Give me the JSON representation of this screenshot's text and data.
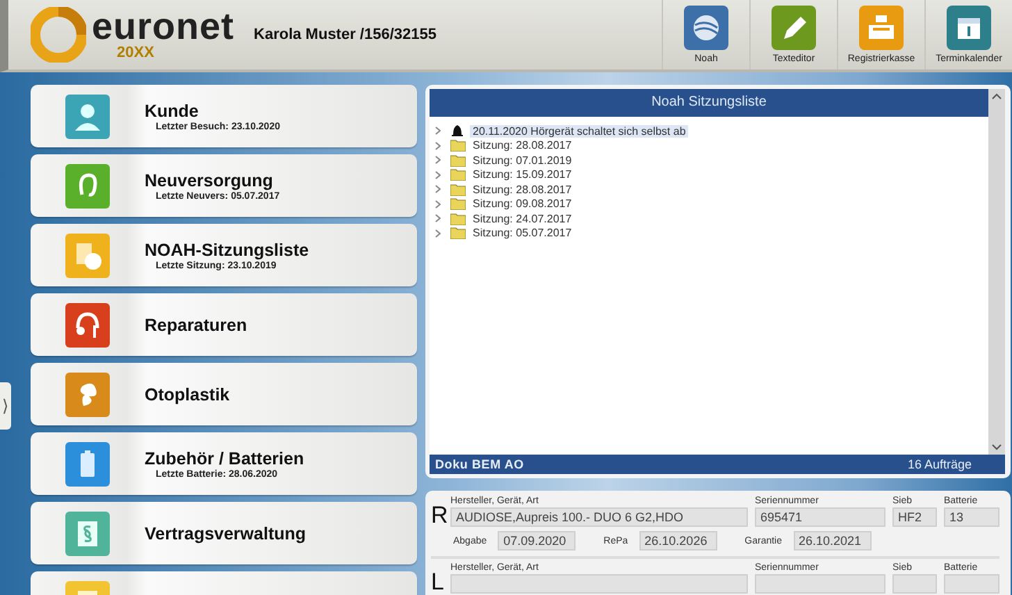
{
  "header": {
    "logo": {
      "name": "euronet",
      "edition": "20XX"
    },
    "customer": "Karola Muster /156/32155",
    "toolbar": [
      {
        "label": "Noah",
        "kind": "noah"
      },
      {
        "label": "Texteditor",
        "kind": "editor"
      },
      {
        "label": "Registrierkasse",
        "kind": "register"
      },
      {
        "label": "Terminkalender",
        "kind": "calendar"
      }
    ]
  },
  "side_handle": "⟩",
  "menu": [
    {
      "label": "Kunde",
      "sub": "Letzter Besuch: 23.10.2020",
      "kind": "person"
    },
    {
      "label": "Neuversorgung",
      "sub": "Letzte Neuvers: 05.07.2017",
      "kind": "hearing-aid"
    },
    {
      "label": "NOAH-Sitzungsliste",
      "sub": "Letzte Sitzung: 23.10.2019",
      "kind": "document"
    },
    {
      "label": "Reparaturen",
      "kind": "repair"
    },
    {
      "label": "Otoplastik",
      "kind": "earmold"
    },
    {
      "label": "Zubehör / Batterien",
      "sub": "Letzte Batterie: 28.06.2020",
      "kind": "battery"
    },
    {
      "label": "Vertragsverwaltung",
      "kind": "contract"
    },
    {
      "kind": "note"
    }
  ],
  "sessions": {
    "title": "Noah Sitzungsliste",
    "items": [
      {
        "label": "20.11.2020 Hörgerät schaltet sich selbst ab",
        "kind": "alert",
        "selected": true
      },
      {
        "label": "Sitzung: 28.08.2017",
        "kind": "folder",
        "selected": false
      },
      {
        "label": "Sitzung: 07.01.2019",
        "kind": "folder",
        "selected": false
      },
      {
        "label": "Sitzung: 15.09.2017",
        "kind": "folder",
        "selected": false
      },
      {
        "label": "Sitzung: 28.08.2017",
        "kind": "folder",
        "selected": false
      },
      {
        "label": "Sitzung: 09.08.2017",
        "kind": "folder",
        "selected": false
      },
      {
        "label": "Sitzung: 24.07.2017",
        "kind": "folder",
        "selected": false
      },
      {
        "label": "Sitzung: 05.07.2017",
        "kind": "folder",
        "selected": false
      }
    ],
    "footer": {
      "label": "Doku BEM AO",
      "count": "16 Aufträge"
    }
  },
  "devices": [
    {
      "side": "R",
      "labels": {
        "device": "Hersteller, Gerät, Art",
        "serial": "Seriennummer",
        "filter": "Sieb",
        "battery": "Batterie",
        "handover": "Abgabe",
        "repa": "RePa",
        "warranty": "Garantie"
      },
      "device": "AUDIOSE,Aupreis 100.- DUO 6 G2,HDO",
      "serial": "695471",
      "filter": "HF2",
      "battery": "13",
      "handover": "07.09.2020",
      "repa": "26.10.2026",
      "warranty": "26.10.2021"
    },
    {
      "side": "L",
      "labels": {
        "device": "Hersteller, Gerät, Art",
        "serial": "Seriennummer",
        "filter": "Sieb",
        "battery": "Batterie"
      }
    }
  ]
}
